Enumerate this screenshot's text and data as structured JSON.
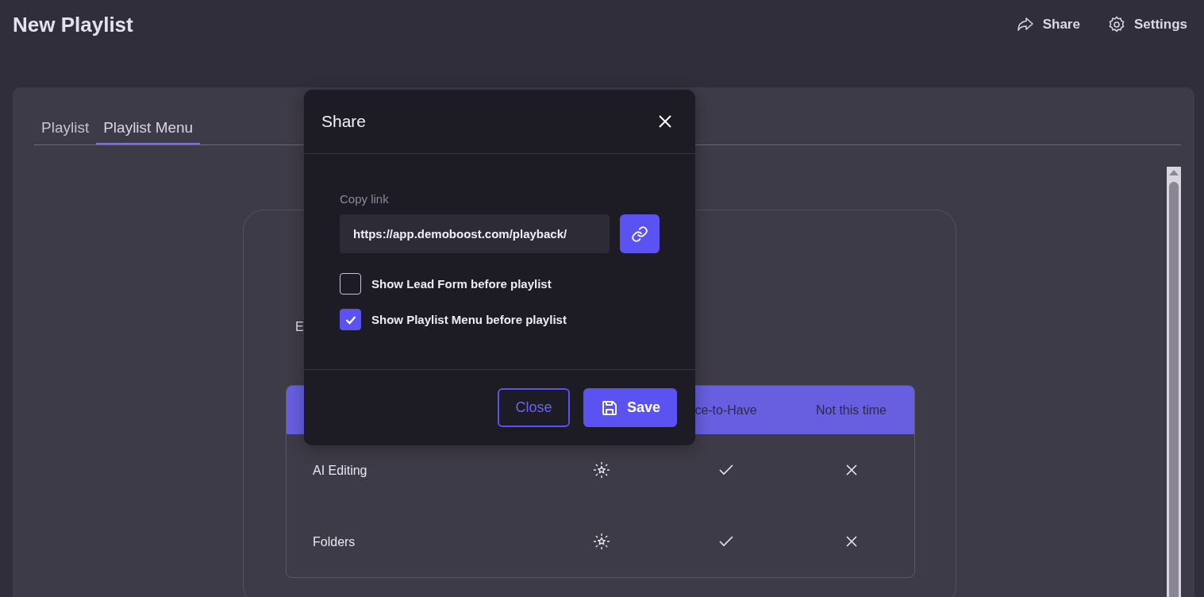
{
  "header": {
    "title": "New Playlist",
    "actions": [
      {
        "label": "Share"
      },
      {
        "label": "Settings"
      }
    ]
  },
  "tabs": [
    {
      "label": "Playlist",
      "selected": false
    },
    {
      "label": "Playlist Menu",
      "selected": true
    }
  ],
  "menu_card": {
    "intro_fragment": "E",
    "table": {
      "columns": [
        "ce-to-Have",
        "Not this time"
      ],
      "rows": [
        {
          "feature": "AI Editing"
        },
        {
          "feature": "Folders"
        }
      ]
    }
  },
  "dialog": {
    "title": "Share",
    "link_label": "Copy link",
    "link_value": "https://app.demoboost.com/playback/",
    "options": [
      {
        "label": "Show Lead Form before playlist",
        "checked": false
      },
      {
        "label": "Show Playlist Menu before playlist",
        "checked": true
      }
    ],
    "buttons": [
      {
        "label": "Close",
        "kind": "secondary"
      },
      {
        "label": "Save",
        "kind": "primary"
      }
    ]
  }
}
